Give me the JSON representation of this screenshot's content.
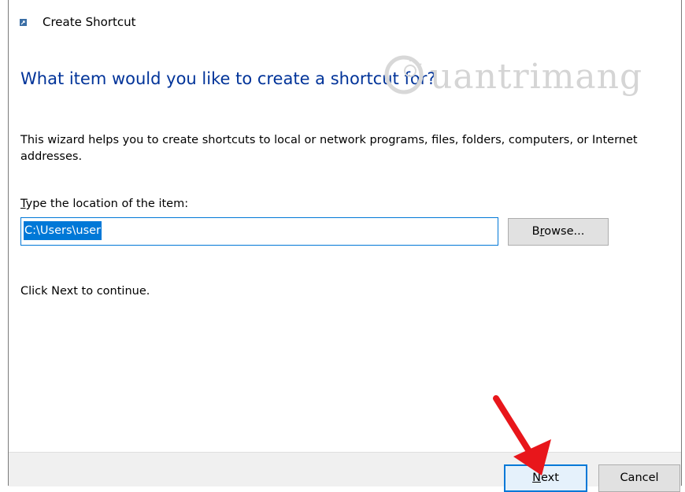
{
  "window": {
    "title": "Create Shortcut"
  },
  "wizard": {
    "heading": "What item would you like to create a shortcut for?",
    "description": "This wizard helps you to create shortcuts to local or network programs, files, folders, computers, or Internet addresses.",
    "location_label_prefix": "T",
    "location_label_rest": "ype the location of the item:",
    "location_value": "C:\\Users\\user",
    "browse_prefix": "B",
    "browse_mid": "r",
    "browse_rest": "owse...",
    "continue_text": "Click Next to continue."
  },
  "footer": {
    "next_prefix": "N",
    "next_rest": "ext",
    "cancel_label": "Cancel"
  },
  "watermark": {
    "text": "uantrimang"
  },
  "colors": {
    "heading": "#003399",
    "accent": "#0078d7",
    "arrow": "#e8161b"
  },
  "icons": {
    "title_icon": "shortcut-icon",
    "annotation": "red-arrow-icon"
  }
}
